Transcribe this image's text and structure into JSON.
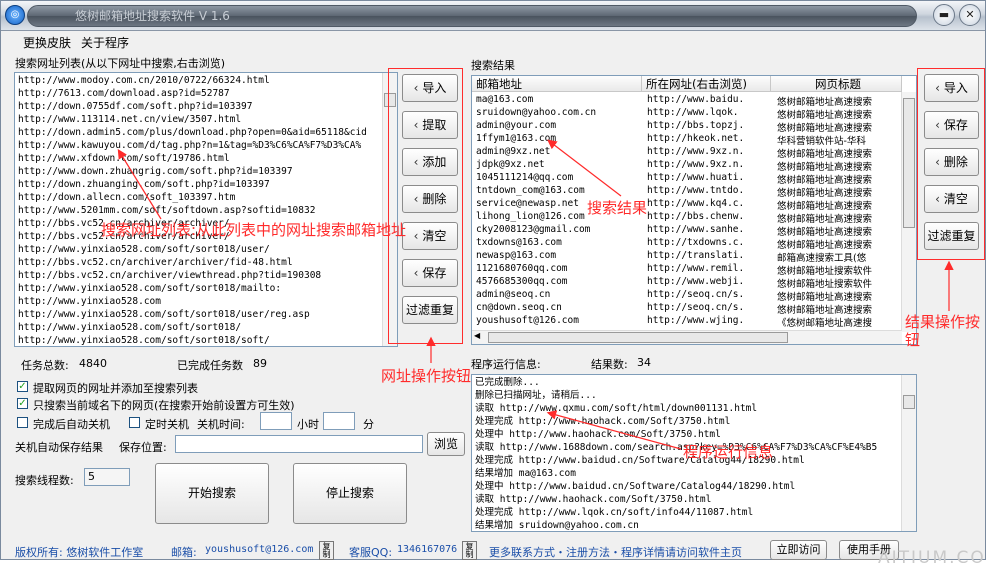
{
  "window": {
    "title": "悠树邮箱地址搜索软件 V 1.6"
  },
  "menu": [
    "更换皮肤",
    "关于程序"
  ],
  "url_list": {
    "label": "搜索网址列表(从以下网址中搜索,右击浏览)",
    "items": [
      "http://www.modoy.com.cn/2010/0722/66324.html",
      "http://7613.com/download.asp?id=52787",
      "http://down.0755df.com/soft.php?id=103397",
      "http://www.113114.net.cn/view/3507.html",
      "http://down.admin5.com/plus/download.php?open=0&aid=65118&cid",
      "http://www.kawuyou.com/d/tag.php?n=1&tag=%D3%C6%CA%F7%D3%CA%",
      "http://www.xfdown.com/soft/19786.html",
      "http://www.down.zhuangrig.com/soft.php?id=103397",
      "http://down.zhuanging.com/soft.php?id=103397",
      "http://down.allecn.com/soft_103397.htm",
      "http://www.5201mm.com/soft/softdown.asp?softid=10832",
      "http://bbs.vc52.cn/archiver/archiver/",
      "http://bbs.vc52.cn/archiver/archiver/",
      "http://www.yinxiao528.com/soft/sort018/user/",
      "http://bbs.vc52.cn/archiver/archiver/fid-48.html",
      "http://bbs.vc52.cn/archiver/viewthread.php?tid=190308",
      "http://www.yinxiao528.com/soft/sort018/mailto:",
      "http://www.yinxiao528.com",
      "http://www.yinxiao528.com/soft/sort018/user/reg.asp",
      "http://www.yinxiao528.com/soft/sort018/",
      "http://www.yinxiao528.com/soft/sort018/soft/"
    ]
  },
  "url_buttons": [
    "导入",
    "提取",
    "添加",
    "删除",
    "清空",
    "保存",
    "过滤重复"
  ],
  "results": {
    "label": "搜索结果",
    "columns": [
      "邮箱地址",
      "所在网址(右击浏览)",
      "网页标题"
    ],
    "rows": [
      [
        "ma@163.com",
        "http://www.baidu.",
        "悠树邮箱地址高速搜索"
      ],
      [
        "sruidown@yahoo.com.cn",
        "http://www.lqok.",
        "悠树邮箱地址高速搜索"
      ],
      [
        "admin@your.com",
        "http://bbs.topzj.",
        "悠树邮箱地址高速搜索"
      ],
      [
        "1ffym1@163.com",
        "http://hkeok.net.",
        "华科营销软件站-华科"
      ],
      [
        "admin@9xz.net",
        "http://www.9xz.n.",
        "悠树邮箱地址高速搜索"
      ],
      [
        "jdpk@9xz.net",
        "http://www.9xz.n.",
        "悠树邮箱地址高速搜索"
      ],
      [
        "1045111214@qq.com",
        "http://www.huati.",
        "悠树邮箱地址高速搜索"
      ],
      [
        "tntdown_com@163.com",
        "http://www.tntdo.",
        "悠树邮箱地址高速搜索"
      ],
      [
        "service@newasp.net",
        "http://www.kq4.c.",
        "悠树邮箱地址高速搜索"
      ],
      [
        "lihong_lion@126.com",
        "http://bbs.chenw.",
        "悠树邮箱地址高速搜索"
      ],
      [
        "cky2008123@gmail.com",
        "http://www.sanhe.",
        "悠树邮箱地址高速搜索"
      ],
      [
        "txdowns@163.com",
        "http://txdowns.c.",
        "悠树邮箱地址高速搜索"
      ],
      [
        "newasp@163.com",
        "http://translati.",
        "邮箱高速搜索工具(悠"
      ],
      [
        "1121680760qq.com",
        "http://www.remil.",
        "悠树邮箱地址搜索软件"
      ],
      [
        "4576685300qq.com",
        "http://www.webji.",
        "悠树邮箱地址搜索软件"
      ],
      [
        "admin@seoq.cn",
        "http://seoq.cn/s.",
        "悠树邮箱地址高速搜索"
      ],
      [
        "cn@down.seoq.cn",
        "http://seoq.cn/s.",
        "悠树邮箱地址高速搜索"
      ],
      [
        "youshusoft@126.com",
        "http://www.wjing.",
        "《悠树邮箱地址高速搜"
      ]
    ]
  },
  "result_buttons": [
    "导入",
    "保存",
    "删除",
    "清空",
    "过滤重复"
  ],
  "stats": {
    "task_total_label": "任务总数:",
    "task_total": "4840",
    "done_label": "已完成任务数",
    "done": "89"
  },
  "log": {
    "label": "程序运行信息:",
    "count_label": "结果数:",
    "count": "34",
    "lines": [
      "已完成删除...",
      "删除已扫描网址，请稍后...",
      "读取 http://www.qxmu.com/soft/html/down001131.html",
      "处理完成 http://www.haohack.com/Soft/3750.html",
      "处理中 http://www.haohack.com/Soft/3750.html",
      "读取 http://www.1688down.com/search.asp?key=%D3%C6%CA%F7%D3%CA%CF%E4%B5",
      "处理完成 http://www.baidud.cn/Software/Catalog44/18290.html",
      "结果增加 ma@163.com",
      "处理中 http://www.baidud.cn/Software/Catalog44/18290.html",
      "读取 http://www.haohack.com/Soft/3750.html",
      "处理完成 http://www.lqok.cn/soft/info44/11087.html",
      "结果增加 sruidown@yahoo.com.cn"
    ]
  },
  "options": {
    "extract_links": "提取网页的网址并添加至搜索列表",
    "only_domain": "只搜索当前域名下的网页(在搜索开始前设置方可生效)",
    "auto_shutdown": "完成后自动关机",
    "timed_shutdown": "定时关机",
    "shutdown_time_label": "关机时间:",
    "hour_label": "小时",
    "minute_label": "分",
    "autosave_label": "关机自动保存结果",
    "save_location_label": "保存位置:",
    "browse": "浏览",
    "threads_label": "搜索线程数:",
    "threads": "5"
  },
  "actions": {
    "start": "开始搜索",
    "stop": "停止搜索"
  },
  "footer": {
    "copyright": "版权所有: 悠树软件工作室",
    "email_label": "邮箱:",
    "email": "youshusoft@126.com",
    "qq_label": "客服QQ:",
    "qq": "1346167076",
    "more": "更多联系方式・注册方法・程序详情请访问软件主页",
    "copy": "复制",
    "visit": "立即访问",
    "manual": "使用手册"
  },
  "annotations": {
    "url_list": "搜索网址列表:从此列表中的网址搜索邮箱地址",
    "results": "搜索结果",
    "url_ops": "网址操作按钮",
    "result_ops": "结果操作按钮",
    "log": "程序运行信息"
  },
  "watermark": "AITIUM.COM"
}
